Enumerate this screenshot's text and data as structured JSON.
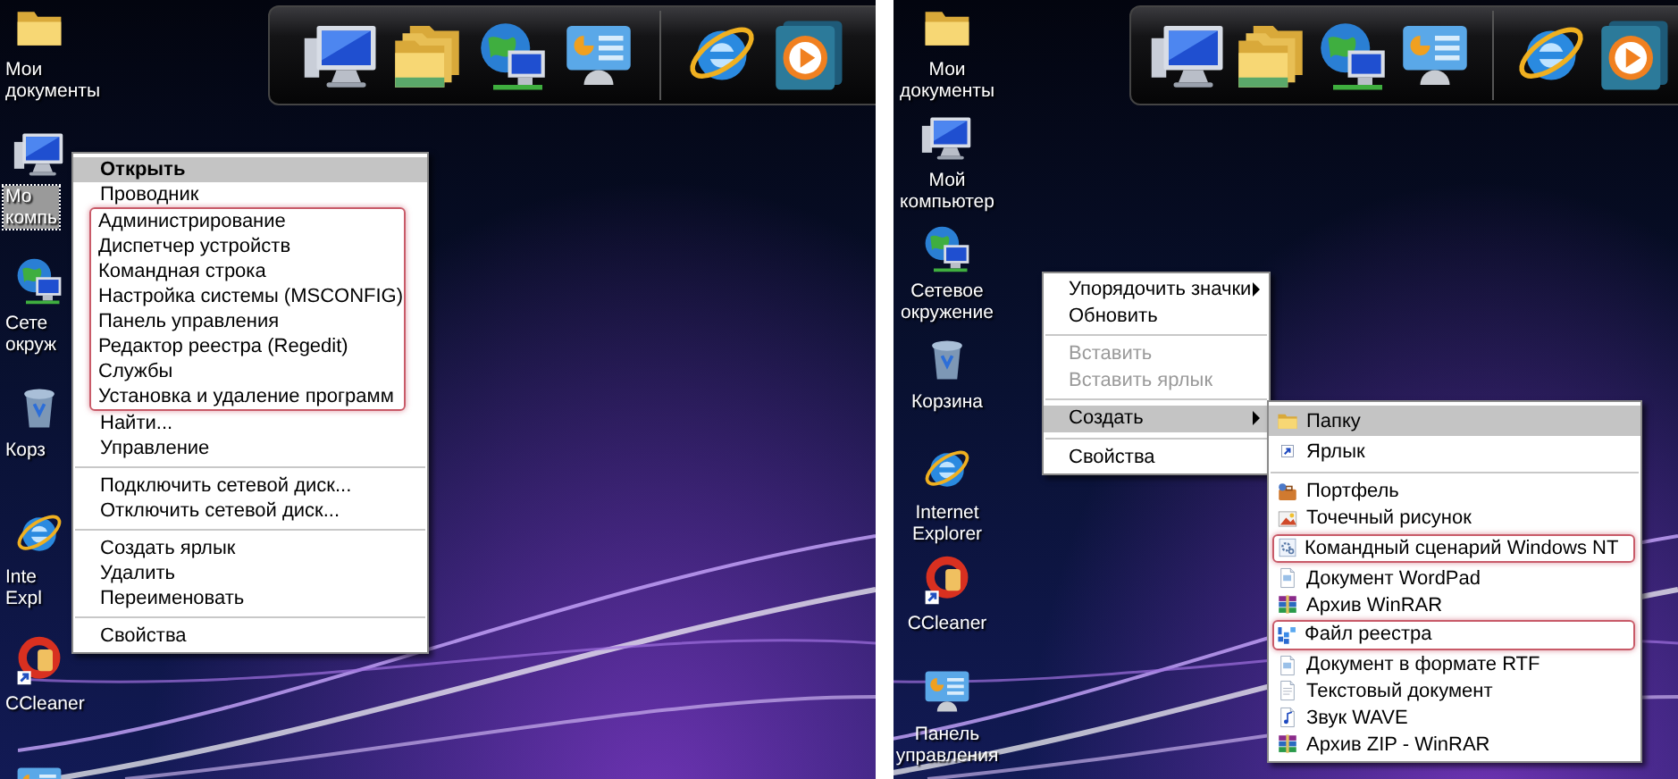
{
  "left_panel": {
    "desktop_icons": [
      {
        "label_lines": [
          "Мои",
          "документы"
        ],
        "selected": false
      },
      {
        "label_lines": [
          "Мо",
          "компь"
        ],
        "selected": true
      },
      {
        "label_lines": [
          "Сете",
          "окруж"
        ],
        "selected": false
      },
      {
        "label_lines": [
          "Корз"
        ],
        "selected": false
      },
      {
        "label_lines": [
          "Inte",
          "Expl"
        ],
        "selected": false
      },
      {
        "label_lines": [
          "CCleaner"
        ],
        "selected": false
      },
      {
        "selected": false
      }
    ],
    "context_menu": {
      "blocks": [
        {
          "kind": "plain",
          "items": [
            {
              "label": "Открыть",
              "selected": true,
              "default": true
            },
            {
              "label": "Проводник",
              "selected": false,
              "default": false
            }
          ]
        },
        {
          "kind": "outlined",
          "items": [
            {
              "label": "Администрирование",
              "selected": false,
              "default": false
            },
            {
              "label": "Диспетчер устройств",
              "selected": false,
              "default": false
            },
            {
              "label": "Командная строка",
              "selected": false,
              "default": false
            },
            {
              "label": "Настройка системы (MSCONFIG)",
              "selected": false,
              "default": false
            },
            {
              "label": "Панель управления",
              "selected": false,
              "default": false
            },
            {
              "label": "Редактор реестра (Regedit)",
              "selected": false,
              "default": false
            },
            {
              "label": "Службы",
              "selected": false,
              "default": false
            },
            {
              "label": "Установка и удаление программ",
              "selected": false,
              "default": false
            }
          ]
        },
        {
          "kind": "plain",
          "items": [
            {
              "label": "Найти...",
              "selected": false,
              "default": false
            },
            {
              "label": "Управление",
              "selected": false,
              "default": false
            }
          ]
        },
        {
          "kind": "separator"
        },
        {
          "kind": "plain",
          "items": [
            {
              "label": "Подключить сетевой диск...",
              "selected": false,
              "default": false
            },
            {
              "label": "Отключить сетевой диск...",
              "selected": false,
              "default": false
            }
          ]
        },
        {
          "kind": "separator"
        },
        {
          "kind": "plain",
          "items": [
            {
              "label": "Создать ярлык",
              "selected": false,
              "default": false
            },
            {
              "label": "Удалить",
              "selected": false,
              "default": false
            },
            {
              "label": "Переименовать",
              "selected": false,
              "default": false
            }
          ]
        },
        {
          "kind": "separator"
        },
        {
          "kind": "plain",
          "items": [
            {
              "label": "Свойства",
              "selected": false,
              "default": false
            }
          ]
        }
      ]
    }
  },
  "right_panel": {
    "desktop_icons": [
      {
        "label_lines": [
          "Мои",
          "документы"
        ],
        "selected": false
      },
      {
        "label_lines": [
          "Мой",
          "компьютер"
        ],
        "selected": false
      },
      {
        "label_lines": [
          "Сетевое",
          "окружение"
        ],
        "selected": false
      },
      {
        "label_lines": [
          "Корзина"
        ],
        "selected": false
      },
      {
        "label_lines": [
          "Internet",
          "Explorer"
        ],
        "selected": false
      },
      {
        "label_lines": [
          "CCleaner"
        ],
        "selected": false
      },
      {
        "label_lines": [
          "Панель",
          "управления"
        ],
        "selected": false
      }
    ],
    "context_menu": {
      "blocks": [
        {
          "kind": "plain",
          "items": [
            {
              "label": "Упорядочить значки",
              "selected": false,
              "disabled": false,
              "submenu": true
            },
            {
              "label": "Обновить",
              "selected": false,
              "disabled": false,
              "submenu": false
            }
          ]
        },
        {
          "kind": "separator"
        },
        {
          "kind": "plain",
          "items": [
            {
              "label": "Вставить",
              "selected": false,
              "disabled": true,
              "submenu": false
            },
            {
              "label": "Вставить ярлык",
              "selected": false,
              "disabled": true,
              "submenu": false
            }
          ]
        },
        {
          "kind": "separator"
        },
        {
          "kind": "plain",
          "items": [
            {
              "label": "Создать",
              "selected": true,
              "disabled": false,
              "submenu": true
            }
          ]
        },
        {
          "kind": "separator"
        },
        {
          "kind": "plain",
          "items": [
            {
              "label": "Свойства",
              "selected": false,
              "disabled": false,
              "submenu": false
            }
          ]
        }
      ]
    },
    "submenu": {
      "blocks": [
        {
          "kind": "plain",
          "items": [
            {
              "label": "Папку",
              "selected": true
            },
            {
              "label": "Ярлык",
              "selected": false
            }
          ]
        },
        {
          "kind": "separator"
        },
        {
          "kind": "plain",
          "items": [
            {
              "label": "Портфель",
              "selected": false
            },
            {
              "label": "Точечный рисунок",
              "selected": false
            }
          ]
        },
        {
          "kind": "outlined",
          "items": [
            {
              "label": "Командный сценарий Windows NT",
              "selected": false
            }
          ]
        },
        {
          "kind": "plain",
          "items": [
            {
              "label": "Документ WordPad",
              "selected": false
            },
            {
              "label": "Архив WinRAR",
              "selected": false
            }
          ]
        },
        {
          "kind": "outlined",
          "items": [
            {
              "label": "Файл реестра",
              "selected": false
            }
          ]
        },
        {
          "kind": "plain",
          "items": [
            {
              "label": "Документ в формате RTF",
              "selected": false
            },
            {
              "label": "Текстовый документ",
              "selected": false
            },
            {
              "label": "Звук WAVE",
              "selected": false
            },
            {
              "label": "Архив ZIP - WinRAR",
              "selected": false
            }
          ]
        }
      ]
    }
  }
}
